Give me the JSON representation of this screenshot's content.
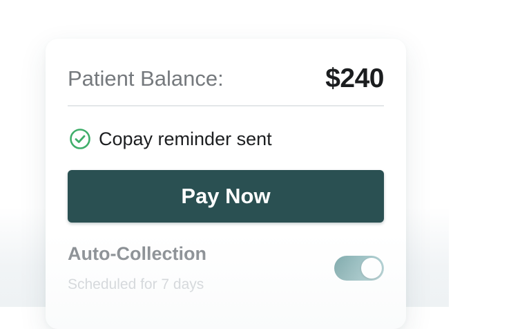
{
  "balance": {
    "label": "Patient Balance:",
    "amount": "$240"
  },
  "status": {
    "icon": "check-circle-icon",
    "text": "Copay reminder sent",
    "color": "#3fae6a"
  },
  "pay_button": {
    "label": "Pay Now",
    "color": "#2a5052"
  },
  "auto_collection": {
    "title": "Auto-Collection",
    "subtitle": "Scheduled for 7 days",
    "toggle_on": true,
    "toggle_color": "#7fabad"
  }
}
